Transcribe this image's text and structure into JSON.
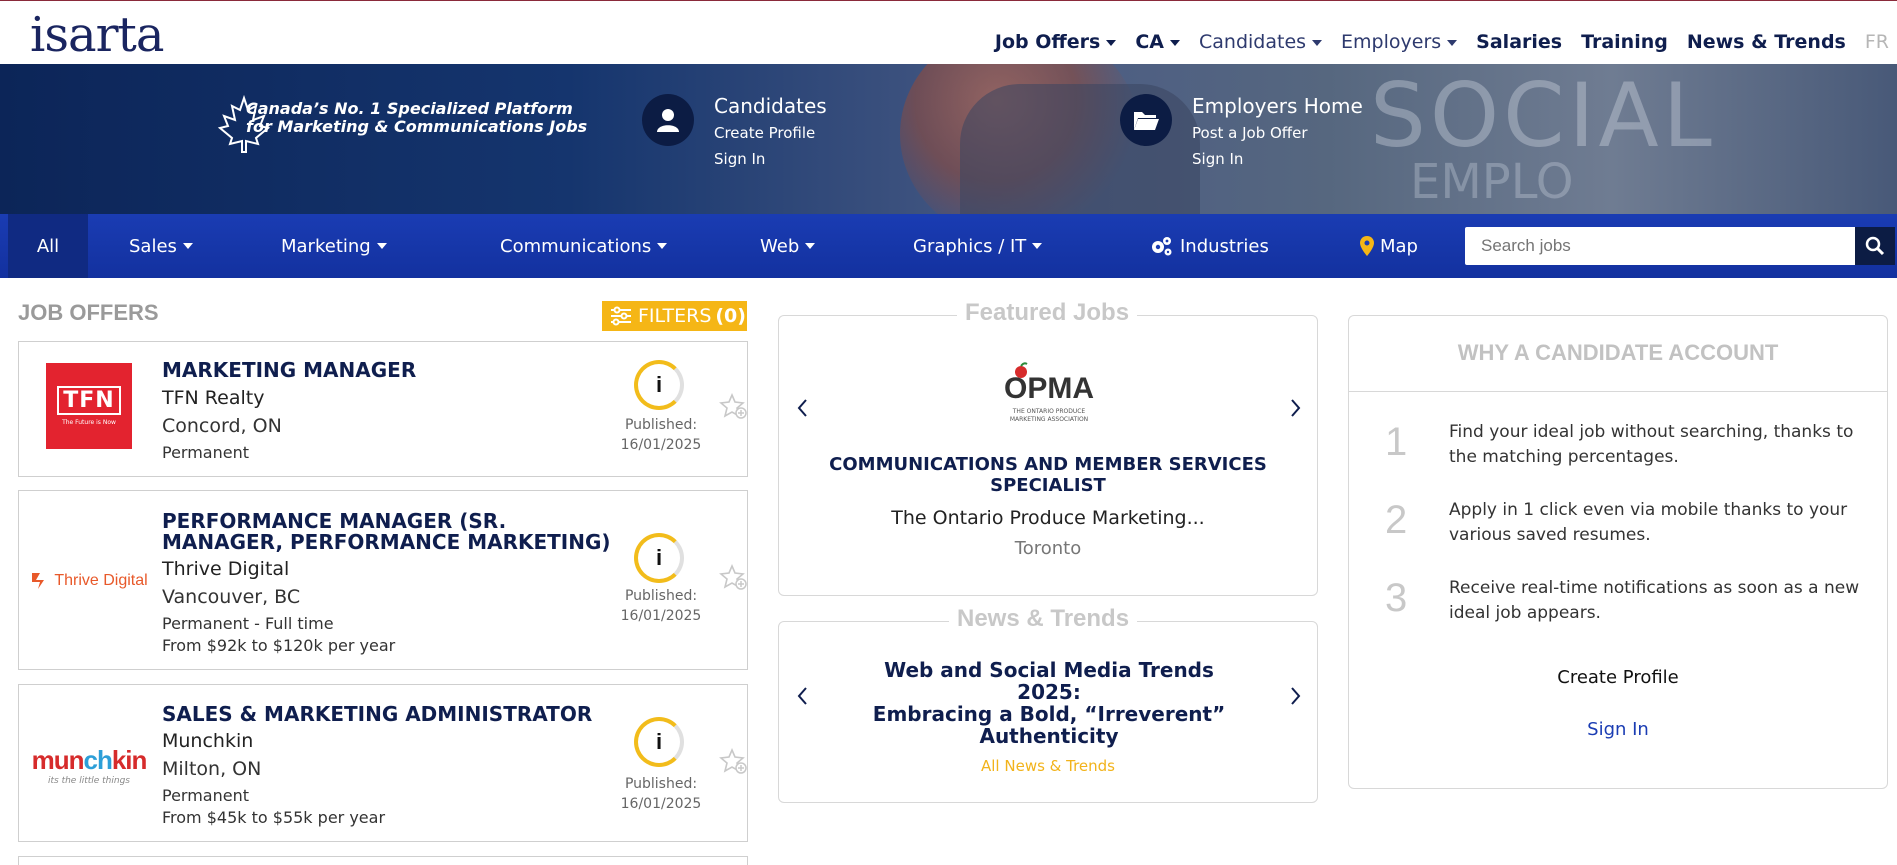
{
  "brand": {
    "logo_text": "isarta",
    "accent": "#f5b616",
    "navy": "#0f1e4e",
    "cat_blue": "#1a3cb3"
  },
  "topnav": {
    "items": [
      {
        "label": "Job Offers",
        "dropdown": true
      },
      {
        "label": "CA",
        "dropdown": true
      },
      {
        "label": "Candidates",
        "dropdown": true
      },
      {
        "label": "Employers",
        "dropdown": true
      },
      {
        "label": "Salaries",
        "dropdown": false
      },
      {
        "label": "Training",
        "dropdown": false
      },
      {
        "label": "News & Trends",
        "dropdown": false
      },
      {
        "label": "FR",
        "dropdown": false
      }
    ]
  },
  "hero": {
    "tagline_line1": "Canada’s No. 1 Specialized Platform",
    "tagline_line2": "for Marketing & Communications Jobs",
    "candidates": {
      "title": "Candidates",
      "link1": "Create Profile",
      "link2": "Sign In",
      "icon": "person-icon"
    },
    "employers": {
      "title": "Employers Home",
      "link1": "Post a Job Offer",
      "link2": "Sign In",
      "icon": "folder-open-icon"
    },
    "background_text_1": "SOCIAL",
    "background_text_2": "EMPLO"
  },
  "categories": {
    "items": [
      {
        "label": "All",
        "active": true
      },
      {
        "label": "Sales",
        "dropdown": true
      },
      {
        "label": "Marketing",
        "dropdown": true
      },
      {
        "label": "Communications",
        "dropdown": true
      },
      {
        "label": "Web",
        "dropdown": true
      },
      {
        "label": "Graphics / IT",
        "dropdown": true
      },
      {
        "label": "Industries",
        "icon": "gears-icon"
      },
      {
        "label": "Map",
        "icon": "map-pin-icon"
      }
    ],
    "search_placeholder": "Search jobs"
  },
  "job_offers": {
    "heading": "JOB OFFERS",
    "filters_label": "FILTERS",
    "filters_count": "(0)",
    "jobs": [
      {
        "title": "MARKETING MANAGER",
        "company": "TFN Realty",
        "location": "Concord, ON",
        "type": "Permanent",
        "salary": "",
        "match": "i",
        "published_label": "Published:",
        "published_date": "16/01/2025",
        "logo_text": "TFN",
        "logo_sub": "The Future is Now"
      },
      {
        "title": "PERFORMANCE MANAGER (SR. MANAGER, PERFORMANCE MARKETING)",
        "company": "Thrive Digital",
        "location": "Vancouver, BC",
        "type": "Permanent - Full time",
        "salary": "From $92k to $120k per year",
        "match": "i",
        "published_label": "Published:",
        "published_date": "16/01/2025",
        "logo_text": "Thrive Digital"
      },
      {
        "title": "SALES & MARKETING ADMINISTRATOR",
        "company": "Munchkin",
        "location": "Milton, ON",
        "type": "Permanent",
        "salary": "From $45k to $55k per year",
        "match": "i",
        "published_label": "Published:",
        "published_date": "16/01/2025",
        "logo_text": "munchkin",
        "logo_sub": "its the little things"
      }
    ]
  },
  "featured": {
    "heading": "Featured Jobs",
    "logo_text": "OPMA",
    "logo_sub": "THE ONTARIO PRODUCE MARKETING ASSOCIATION",
    "title_line1": "COMMUNICATIONS AND MEMBER SERVICES",
    "title_line2": "SPECIALIST",
    "company": "The Ontario Produce Marketing...",
    "location": "Toronto"
  },
  "news": {
    "heading": "News & Trends",
    "title_line1": "Web and Social Media Trends 2025:",
    "title_line2": "Embracing a Bold, “Irreverent”",
    "title_line3": "Authenticity",
    "link": "All News & Trends"
  },
  "why": {
    "heading": "WHY A CANDIDATE ACCOUNT",
    "items": [
      {
        "num": "1",
        "text": "Find your ideal job without searching, thanks to the matching percentages."
      },
      {
        "num": "2",
        "text": "Apply in 1 click even via mobile thanks to your various saved resumes."
      },
      {
        "num": "3",
        "text": "Receive real-time notifications as soon as a new ideal job appears."
      }
    ],
    "create_profile": "Create Profile",
    "sign_in": "Sign In"
  }
}
